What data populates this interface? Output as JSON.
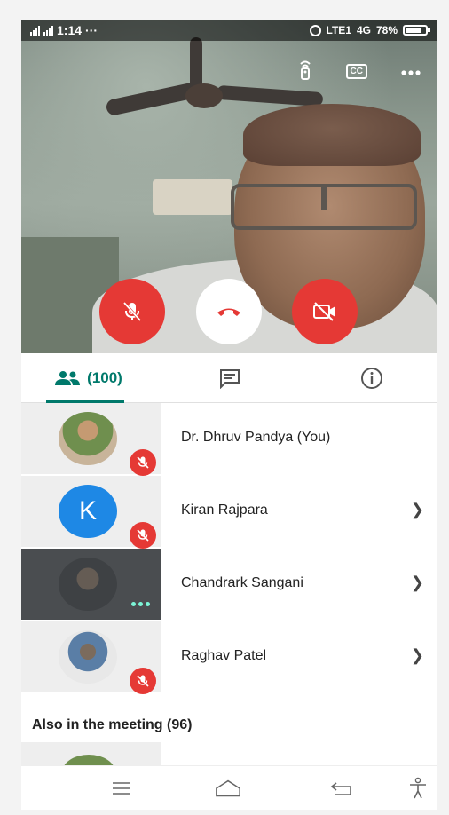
{
  "status_bar": {
    "time": "1:14",
    "more": "···",
    "network": "LTE1",
    "network_type": "4G",
    "battery": "78%"
  },
  "video_controls": {
    "captions_label": "CC"
  },
  "tabs": {
    "people_count": "(100)"
  },
  "participants": [
    {
      "name": "Dr. Dhruv Pandya (You)",
      "avatar_initial": "",
      "muted": true
    },
    {
      "name": "Kiran Rajpara",
      "avatar_initial": "K",
      "muted": true
    },
    {
      "name": "Chandrark Sangani",
      "avatar_initial": "",
      "muted": false
    },
    {
      "name": "Raghav Patel",
      "avatar_initial": "",
      "muted": true
    }
  ],
  "also_in_meeting": "Also in the meeting (96)",
  "colors": {
    "accent": "#00796b",
    "mute_red": "#e53935",
    "avatar_blue": "#1e88e5"
  }
}
